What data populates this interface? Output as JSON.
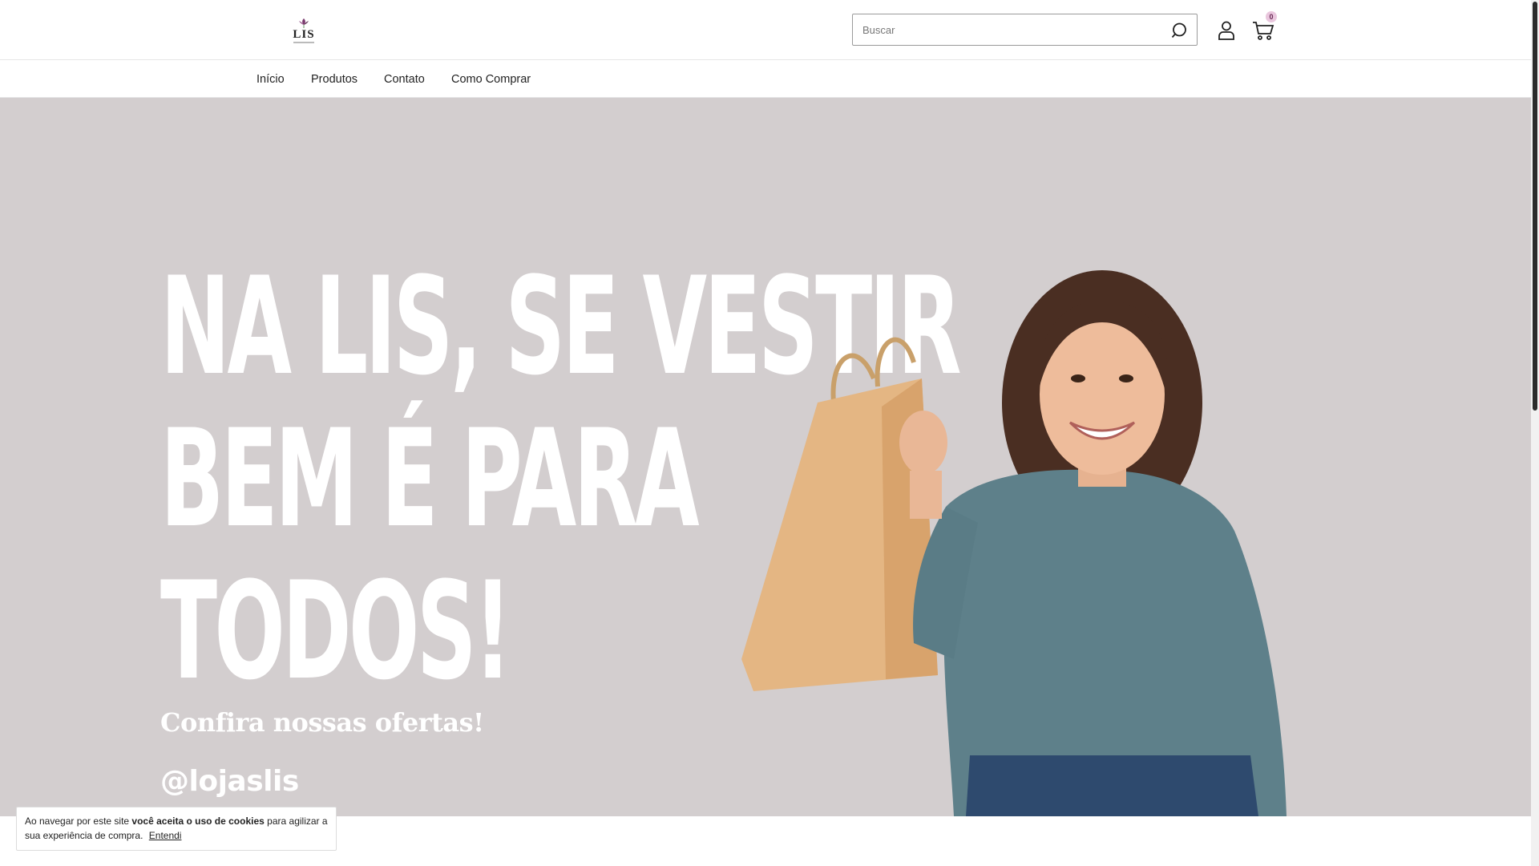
{
  "header": {
    "logo_text": "LIS",
    "search": {
      "placeholder": "Buscar",
      "value": ""
    },
    "cart_count": "0",
    "icons": {
      "search": "search-icon",
      "account": "user-icon",
      "cart": "cart-icon"
    }
  },
  "nav": {
    "items": [
      {
        "label": "Início"
      },
      {
        "label": "Produtos"
      },
      {
        "label": "Contato"
      },
      {
        "label": "Como Comprar"
      }
    ]
  },
  "hero": {
    "headline_lines": [
      "NA LIS, SE VESTIR",
      "BEM É PARA",
      "TODOS!"
    ],
    "subline": "Confira nossas ofertas!",
    "handle": "@lojaslis",
    "background_color": "#d3cecf"
  },
  "cookie_notice": {
    "text_before": "Ao navegar por este site ",
    "text_bold": "você aceita o uso de cookies",
    "text_after": " para agilizar a sua experiência de compra.",
    "accept_label": "Entendi"
  },
  "colors": {
    "badge": "#e9c6dd",
    "logo_flower": "#7a3a6e"
  }
}
